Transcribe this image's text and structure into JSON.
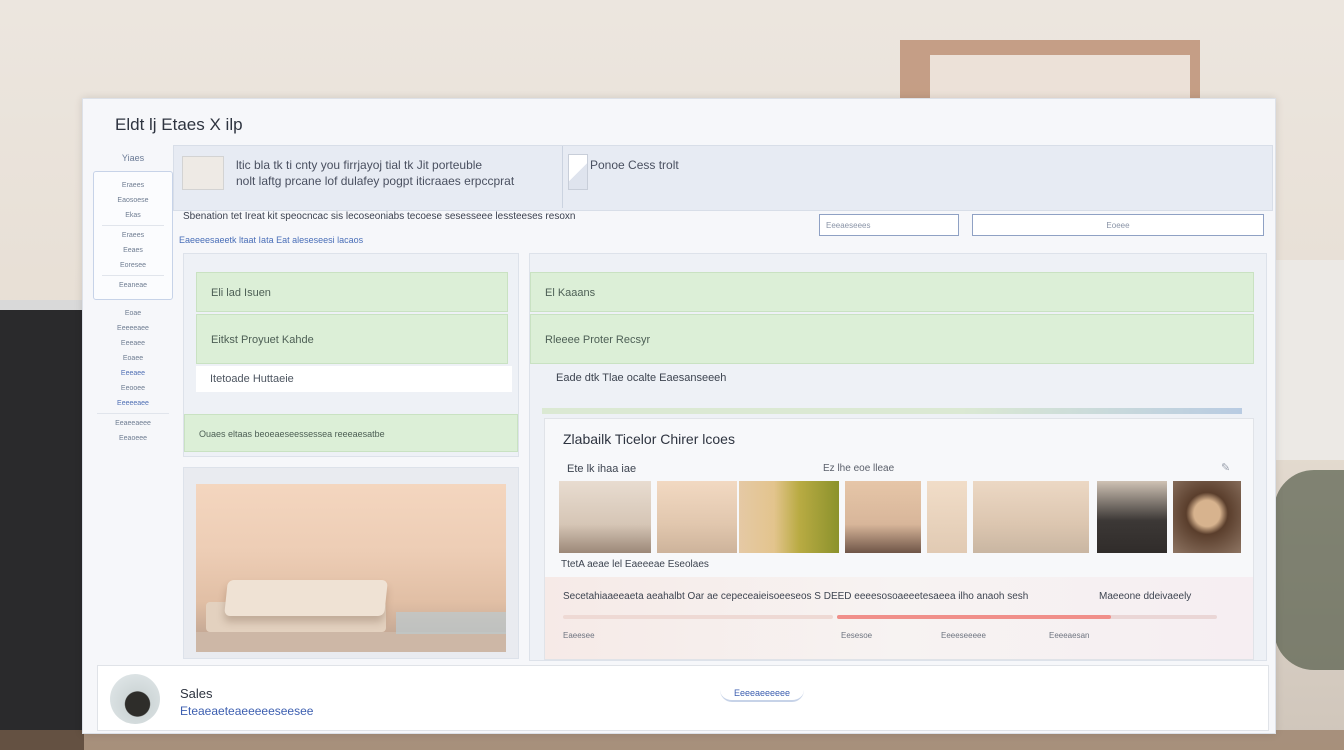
{
  "window": {
    "title": "Eldt lj Etaes X ilp"
  },
  "sidebar": {
    "header": "Yiaes",
    "group1": [
      "Eraees",
      "Eaosoese",
      "Ekas"
    ],
    "group2": [
      "Eraees",
      "Eeaes",
      "Eoresee"
    ],
    "group3": [
      "Eeaneae"
    ],
    "items": [
      "Eoae",
      "Eeeeeaee",
      "Eeeaee",
      "Eoaee",
      "Eeeaee",
      "Eeooee",
      "Eeeeeaee",
      "Eeaeeaeee",
      "Eeaoeee"
    ]
  },
  "banner": {
    "line1": "ltic bla tk ti cnty you firrjayoj tial tk Jit porteuble",
    "line2": "nolt laftg prcane lof dulafey pogpt iticraaes erpccprat",
    "right": "Ponoe Cess trolt"
  },
  "info": {
    "line1": "Sbenation tet Ireat kit speocncac sis lecoseoniabs tecoese sesesseee lessteeses resoxn",
    "line2": "Eaeeeesaeetk ltaat Iata Eat aleseseesi lacaos",
    "search_placeholder": "Eeeaeseees",
    "filter_placeholder": "Eoeee"
  },
  "left_panel": {
    "row1": "Eli lad Isuen",
    "row2": "Eitkst Proyuet Kahde",
    "row3": "Itetoade Huttaeie",
    "row4": "Ouaes eltaas beoeaeseessessea reeeaesatbe"
  },
  "right_panel": {
    "row1": "El Kaaans",
    "row2": "Rleeee Proter Recsyr",
    "row3": "Eade dtk Tlae ocalte Eaesanseeeh"
  },
  "gallery": {
    "title": "Zlabailk Ticelor Chirer lcoes",
    "sub_left": "Ete lk ihaa iae",
    "sub_right": "Ez lhe eoe lleae",
    "caption": "TtetA aeae lel Eaeeeae Eseolaes",
    "footer_text": "Secetahiaaeeaeta aeahalbt Oar ae cepeceaieisoeeseos S DEED eeeesosoaeeetesaeea ilho anaoh sesh",
    "footer_right": "Maeeone ddeivaeely",
    "progress": 0.72,
    "labels": [
      "Eaeesee",
      "Eesesoe",
      "Eeeeseeeee",
      "Eeeeaesan"
    ]
  },
  "profile": {
    "name": "Sales",
    "sub": "Eteaeaeteaeeeeeseesee",
    "button": "Eeeeaeeeeee"
  },
  "colors": {
    "accent": "#4f6fb4",
    "green_row": "#dcefd7",
    "progress": "#f08f8a"
  }
}
